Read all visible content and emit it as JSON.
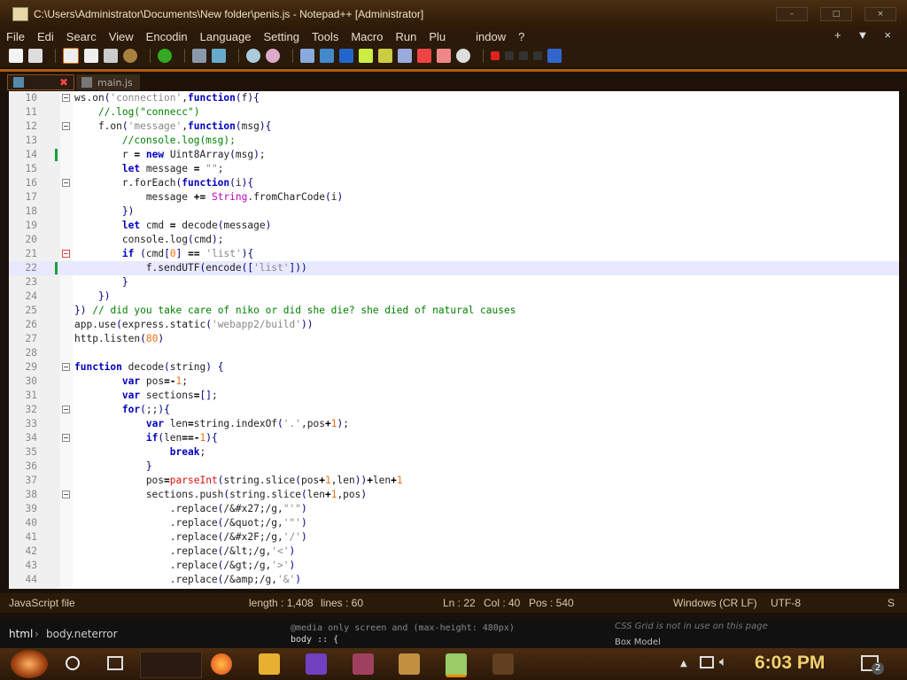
{
  "window": {
    "title": "C:\\Users\\Administrator\\Documents\\New folder\\penis.js - Notepad++ [Administrator]",
    "controls": [
      "minimize",
      "maximize",
      "close"
    ]
  },
  "menu": {
    "items": [
      "File",
      "Edi",
      "Searc",
      "View",
      "Encodin",
      "Language",
      "Setting",
      "Tools",
      "Macro",
      "Run",
      "Plu",
      "indow",
      "?"
    ],
    "right": [
      "+",
      "▼",
      "×"
    ]
  },
  "tabs": [
    {
      "label": "",
      "active": true
    },
    {
      "label": "main.js",
      "active": false
    }
  ],
  "editor": {
    "current_line": 22,
    "lines": [
      {
        "n": "10",
        "fold": "box"
      },
      {
        "n": "11"
      },
      {
        "n": "12",
        "fold": "box"
      },
      {
        "n": "13"
      },
      {
        "n": "14",
        "changed": true
      },
      {
        "n": "15"
      },
      {
        "n": "16",
        "fold": "box"
      },
      {
        "n": "17"
      },
      {
        "n": "18"
      },
      {
        "n": "19"
      },
      {
        "n": "20"
      },
      {
        "n": "21",
        "fold": "red"
      },
      {
        "n": "22",
        "changed": true
      },
      {
        "n": "23"
      },
      {
        "n": "24"
      },
      {
        "n": "25"
      },
      {
        "n": "26"
      },
      {
        "n": "27"
      },
      {
        "n": "28"
      },
      {
        "n": "29",
        "fold": "box"
      },
      {
        "n": "30"
      },
      {
        "n": "31"
      },
      {
        "n": "32",
        "fold": "box"
      },
      {
        "n": "33"
      },
      {
        "n": "34",
        "fold": "box"
      },
      {
        "n": "35"
      },
      {
        "n": "36"
      },
      {
        "n": "37"
      },
      {
        "n": "38",
        "fold": "box"
      },
      {
        "n": "39"
      },
      {
        "n": "40"
      },
      {
        "n": "41"
      },
      {
        "n": "42"
      },
      {
        "n": "43"
      },
      {
        "n": "44"
      }
    ],
    "code": [
      "ws.on('connection',function(f){",
      "    //.log(\"connecc\")",
      "    f.on('message',function(msg){",
      "        //console.log(msg);",
      "        r = new Uint8Array(msg);",
      "        let message = \"\";",
      "        r.forEach(function(i){",
      "            message += String.fromCharCode(i)",
      "        })",
      "        let cmd = decode(message)",
      "        console.log(cmd);",
      "        if (cmd[0] == 'list'){",
      "            f.sendUTF(encode(['list']))",
      "        }",
      "    })",
      "}) // did you take care of niko or did she die? she died of natural causes",
      "app.use(express.static('webapp2/build'))",
      "http.listen(80)",
      "",
      "function decode(string) {",
      "        var pos=-1;",
      "        var sections=[];",
      "        for(;;){",
      "            var len=string.indexOf('.',pos+1);",
      "            if(len==-1){",
      "                break;",
      "            }",
      "            pos=parseInt(string.slice(pos+1,len))+len+1",
      "            sections.push(string.slice(len+1,pos)",
      "                .replace(/&#x27;/g,\"'\")",
      "                .replace(/&quot;/g,'\"')",
      "                .replace(/&#x2F;/g,'/')",
      "                .replace(/&lt;/g,'<')",
      "                .replace(/&gt;/g,'>')",
      "                .replace(/&amp;/g,'&')"
    ]
  },
  "status": {
    "filetype": "JavaScript file",
    "length": "length : 1,408",
    "lines": "lines : 60",
    "ln": "Ln : 22",
    "col": "Col : 40",
    "pos": "Pos : 540",
    "eol": "Windows (CR LF)",
    "encoding": "UTF-8",
    "mode": "S"
  },
  "devtools": {
    "crumb_html": "html",
    "crumb_body": "body.neterror",
    "css_line1": "@media only screen and (max-height: 480px)",
    "css_line2": "body :: {",
    "note": "CSS Grid is not in use on this page",
    "box_model": "Box Model"
  },
  "taskbar": {
    "clock": "6:03 PM",
    "notification_count": "2"
  },
  "colors": {
    "accent_orange": "#b05c10",
    "clock": "#f0d070",
    "keyword": "#0000c0",
    "comment": "#008000"
  }
}
